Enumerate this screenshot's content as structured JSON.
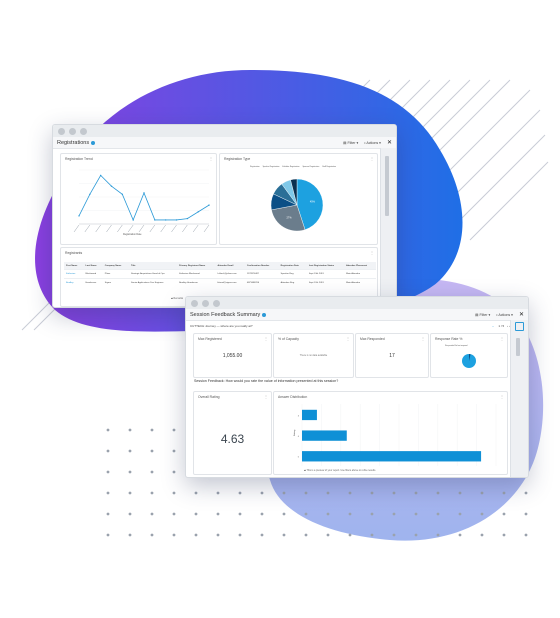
{
  "colors": {
    "blob_start": "#8a3fe0",
    "blob_end": "#1f6fe6",
    "blob_light": "#a7a7ef",
    "accent": "#2c9ad7",
    "bar": "#0f90d6"
  },
  "registrations": {
    "title": "Registrations",
    "toolbar": {
      "filter_label": "Filter",
      "actions_label": "Actions"
    },
    "trend_panel": {
      "title": "Registration Trend",
      "x_axis_label": "Registration Date",
      "chart_data": {
        "type": "line",
        "values": [
          6,
          22,
          36,
          28,
          22,
          3,
          23,
          3,
          3,
          3,
          4,
          9,
          14
        ],
        "ylim": [
          0,
          40
        ]
      }
    },
    "type_panel": {
      "title": "Registration Type",
      "legend": [
        "Registration",
        "Speaker Registration",
        "Exhibitor Registration",
        "Sponsor Registration",
        "Staff Registration"
      ],
      "chart_data": {
        "type": "pie",
        "values": [
          45,
          27,
          10,
          8,
          6,
          4
        ],
        "colors": [
          "#1da1e0",
          "#6b7d8c",
          "#0b4f86",
          "#2a6f97",
          "#7fc8e8",
          "#0a2f4f"
        ],
        "labels": [
          "45%",
          "27%",
          "",
          "",
          "",
          ""
        ]
      }
    },
    "list_panel": {
      "title": "Registrants",
      "columns": [
        "First Name",
        "Last Name",
        "Company Name",
        "Title",
        "Primary Registrant Name",
        "Attendee Email",
        "Confirmation Number",
        "Registration Date",
        "Last Registration Status",
        "Attendee Placement"
      ],
      "rows": [
        [
          "Katherine",
          "Blackwood",
          "Pfizer",
          "Strategic Acquisitions Head of Ops",
          "Katherine Blackwood",
          "k.black@pfizer.com",
          "1178970487",
          "Speaker Reg.",
          "Sept 13th 2019",
          "Main Attendee"
        ],
        [
          "Bradley",
          "Henderson",
          "Sigma",
          "Senior Applications Dev Engineer",
          "Bradley Henderson",
          "bhend@sigma.com",
          "0873488766",
          "Attendee Reg.",
          "Sept 12th 2019",
          "Main Attendee"
        ]
      ]
    },
    "footer_text": "Remarks"
  },
  "feedback": {
    "title": "Session Feedback Summary",
    "toolbar": {
      "filter_label": "Filter",
      "actions_label": "Actions"
    },
    "session_filter": {
      "value": "CUTTECH Journey — where are you really at?",
      "count": "1 / 5"
    },
    "kpis": [
      {
        "title": "Max Registered",
        "value": "1,055.00"
      },
      {
        "title": "% of Capacity",
        "value": "There is no data available"
      },
      {
        "title": "Max Responded",
        "value": "17"
      },
      {
        "title": "Response Rate %",
        "legend": "Responded  Did not respond"
      }
    ],
    "question": "Session Feedback: How would you rate the value of information presented at this session?",
    "rating_panel": {
      "title": "Overall Rating",
      "value": "4.63"
    },
    "distribution_panel": {
      "title": "Answer Distribution",
      "y_axis_label": "Rating",
      "chart_data": {
        "type": "bar",
        "categories": [
          "3",
          "4",
          "5"
        ],
        "values": [
          1,
          3,
          12
        ],
        "xlim": [
          0,
          13
        ]
      }
    },
    "footer_text": "This is a preview of your report. Use filters above to refine results."
  }
}
